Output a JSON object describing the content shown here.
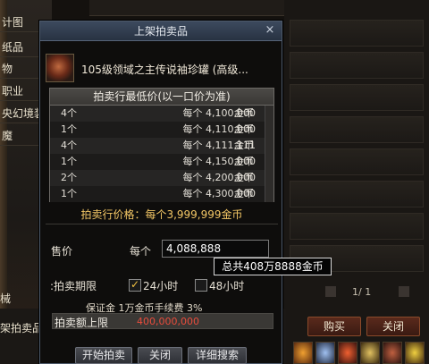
{
  "background": {
    "left_menu": [
      "计图",
      "纸品",
      "物",
      "职业",
      "央幻境装",
      "魔"
    ],
    "left_bottom_label": "械",
    "shop_label": "架拍卖品",
    "pager": "1/ 1",
    "buy_button": "购买",
    "close_button": "关闭"
  },
  "dialog": {
    "title": "上架拍卖品",
    "close_glyph": "×",
    "item_name": "105级领域之主传说袖珍罐 (高级...",
    "table_header": "拍卖行最低价(以一口价为准)",
    "rows": [
      {
        "qty": "4个",
        "each": "每个 4,100,000",
        "unit": "金币"
      },
      {
        "qty": "1个",
        "each": "每个 4,110,000",
        "unit": "金币"
      },
      {
        "qty": "4个",
        "each": "每个 4,111,111",
        "unit": "金币"
      },
      {
        "qty": "1个",
        "each": "每个 4,150,000",
        "unit": "金币"
      },
      {
        "qty": "2个",
        "each": "每个 4,200,000",
        "unit": "金币"
      },
      {
        "qty": "1个",
        "each": "每个 4,300,000",
        "unit": "金币"
      }
    ],
    "market_price": "拍卖行价格：每个3,999,999金币",
    "price_label": "售价",
    "each_label": "每个",
    "price_value": "4,088,888",
    "tooltip": "总共408万8888金币",
    "period_label": ":拍卖期限",
    "option_24h": "24小时",
    "option_48h": "48小时",
    "deposit": "保证金  1万金币手续费  3%",
    "limit_label": "拍卖额上限",
    "limit_value": "400,000,000",
    "start_button": "开始拍卖",
    "close_button": "关闭",
    "detail_button": "详细搜索"
  }
}
